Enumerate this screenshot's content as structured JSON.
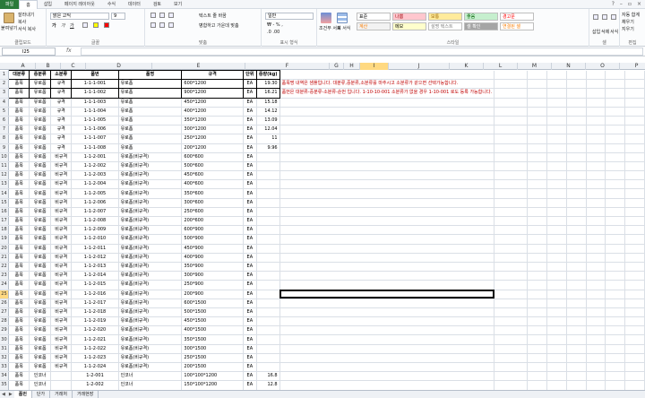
{
  "menu": {
    "file": "파일",
    "tabs": [
      "홈",
      "삽입",
      "페이지 레이아웃",
      "수식",
      "데이터",
      "검토",
      "보기"
    ],
    "active_index": 0
  },
  "ribbon": {
    "clipboard": {
      "label": "클립보드",
      "paste": "붙여넣기",
      "cut": "잘라내기",
      "copy": "복사",
      "format_painter": "서식 복사"
    },
    "font": {
      "label": "글꼴",
      "name": "맑은 고딕",
      "size": "9",
      "bold": "가",
      "italic": "가",
      "underline": "가"
    },
    "align": {
      "label": "맞춤",
      "wrap": "텍스트 줄 바꿈",
      "merge": "병합하고 가운데 맞춤"
    },
    "number": {
      "label": "표시 형식",
      "format": "일반"
    },
    "styles": {
      "label": "스타일",
      "cond": "조건부 서식",
      "table": "표 서식",
      "cells": [
        {
          "text": "표준",
          "bg": "#ffffff",
          "fg": "#000000"
        },
        {
          "text": "나쁨",
          "bg": "#ffc7ce",
          "fg": "#9c0006"
        },
        {
          "text": "보통",
          "bg": "#ffeb9c",
          "fg": "#9c6500"
        },
        {
          "text": "좋음",
          "bg": "#c6efce",
          "fg": "#006100"
        },
        {
          "text": "경고문",
          "bg": "#ffffff",
          "fg": "#ff0000"
        },
        {
          "text": "계산",
          "bg": "#f2f2f2",
          "fg": "#fa7d00"
        },
        {
          "text": "메모",
          "bg": "#ffffcc",
          "fg": "#000000"
        },
        {
          "text": "설명 텍스트",
          "bg": "#ffffff",
          "fg": "#7f7f7f"
        },
        {
          "text": "셀 확인",
          "bg": "#a5a5a5",
          "fg": "#ffffff"
        },
        {
          "text": "연결된 셀",
          "bg": "#ffffff",
          "fg": "#fa7d00"
        }
      ]
    },
    "cells": {
      "label": "셀",
      "insert": "삽입",
      "delete": "삭제",
      "format": "서식"
    },
    "editing": {
      "label": "편집",
      "autosum": "자동 합계",
      "fill": "채우기",
      "clear": "지우기"
    }
  },
  "formula_bar": {
    "name_box": "I25",
    "fx": "fx",
    "content": ""
  },
  "columns": [
    {
      "id": "A",
      "w": 28
    },
    {
      "id": "B",
      "w": 28
    },
    {
      "id": "C",
      "w": 28
    },
    {
      "id": "D",
      "w": 74
    },
    {
      "id": "E",
      "w": 104
    },
    {
      "id": "F",
      "w": 94
    },
    {
      "id": "G",
      "w": 16
    },
    {
      "id": "H",
      "w": 18
    },
    {
      "id": "I",
      "w": 32
    },
    {
      "id": "J",
      "w": 68
    },
    {
      "id": "K",
      "w": 38
    },
    {
      "id": "L",
      "w": 38
    },
    {
      "id": "M",
      "w": 38
    },
    {
      "id": "N",
      "w": 38
    },
    {
      "id": "O",
      "w": 38
    },
    {
      "id": "P",
      "w": 38
    }
  ],
  "selected_col": "I",
  "selected_row": 25,
  "headers": [
    "대분류",
    "중분류",
    "소분류",
    "품번",
    "품명",
    "규격",
    "단위",
    "중량(kg)"
  ],
  "notes": {
    "row2": "품목명 내역은 샘플입니다. 대분류,중분류,소분류를 마추시고 소분류가 같으면 선택가능합니다.",
    "row3": "품번은 대분류-중분류-소분류-순번 입니다. 1-10-10-001 소분류가 없을 경우 1-10-001 로도 등록 가능합니다."
  },
  "rows": [
    [
      "품목",
      "유로폼",
      "규격",
      "1-1-1-001",
      "유로폼",
      "600*1200",
      "EA",
      "19.30"
    ],
    [
      "품목",
      "유로폼",
      "규격",
      "1-1-1-002",
      "유로폼",
      "900*1200",
      "EA",
      "16.21"
    ],
    [
      "품목",
      "유로폼",
      "규격",
      "1-1-1-003",
      "유로폼",
      "450*1200",
      "EA",
      "15.18"
    ],
    [
      "품목",
      "유로폼",
      "규격",
      "1-1-1-004",
      "유로폼",
      "400*1200",
      "EA",
      "14.12"
    ],
    [
      "품목",
      "유로폼",
      "규격",
      "1-1-1-005",
      "유로폼",
      "350*1200",
      "EA",
      "13.09"
    ],
    [
      "품목",
      "유로폼",
      "규격",
      "1-1-1-006",
      "유로폼",
      "300*1200",
      "EA",
      "12.04"
    ],
    [
      "품목",
      "유로폼",
      "규격",
      "1-1-1-007",
      "유로폼",
      "250*1200",
      "EA",
      "11"
    ],
    [
      "품목",
      "유로폼",
      "규격",
      "1-1-1-008",
      "유로폼",
      "200*1200",
      "EA",
      "9.96"
    ],
    [
      "품목",
      "유로폼",
      "비규격",
      "1-1-2-001",
      "유로폼(비규격)",
      "600*600",
      "EA",
      ""
    ],
    [
      "품목",
      "유로폼",
      "비규격",
      "1-1-2-002",
      "유로폼(비규격)",
      "500*600",
      "EA",
      ""
    ],
    [
      "품목",
      "유로폼",
      "비규격",
      "1-1-2-003",
      "유로폼(비규격)",
      "450*600",
      "EA",
      ""
    ],
    [
      "품목",
      "유로폼",
      "비규격",
      "1-1-2-004",
      "유로폼(비규격)",
      "400*600",
      "EA",
      ""
    ],
    [
      "품목",
      "유로폼",
      "비규격",
      "1-1-2-005",
      "유로폼(비규격)",
      "350*600",
      "EA",
      ""
    ],
    [
      "품목",
      "유로폼",
      "비규격",
      "1-1-2-006",
      "유로폼(비규격)",
      "300*600",
      "EA",
      ""
    ],
    [
      "품목",
      "유로폼",
      "비규격",
      "1-1-2-007",
      "유로폼(비규격)",
      "250*600",
      "EA",
      ""
    ],
    [
      "품목",
      "유로폼",
      "비규격",
      "1-1-2-008",
      "유로폼(비규격)",
      "200*600",
      "EA",
      ""
    ],
    [
      "품목",
      "유로폼",
      "비규격",
      "1-1-2-009",
      "유로폼(비규격)",
      "600*900",
      "EA",
      ""
    ],
    [
      "품목",
      "유로폼",
      "비규격",
      "1-1-2-010",
      "유로폼(비규격)",
      "500*900",
      "EA",
      ""
    ],
    [
      "품목",
      "유로폼",
      "비규격",
      "1-1-2-011",
      "유로폼(비규격)",
      "450*900",
      "EA",
      ""
    ],
    [
      "품목",
      "유로폼",
      "비규격",
      "1-1-2-012",
      "유로폼(비규격)",
      "400*900",
      "EA",
      ""
    ],
    [
      "품목",
      "유로폼",
      "비규격",
      "1-1-2-013",
      "유로폼(비규격)",
      "350*900",
      "EA",
      ""
    ],
    [
      "품목",
      "유로폼",
      "비규격",
      "1-1-2-014",
      "유로폼(비규격)",
      "300*900",
      "EA",
      ""
    ],
    [
      "품목",
      "유로폼",
      "비규격",
      "1-1-2-015",
      "유로폼(비규격)",
      "250*900",
      "EA",
      ""
    ],
    [
      "품목",
      "유로폼",
      "비규격",
      "1-1-2-016",
      "유로폼(비규격)",
      "200*900",
      "EA",
      ""
    ],
    [
      "품목",
      "유로폼",
      "비규격",
      "1-1-2-017",
      "유로폼(비규격)",
      "600*1500",
      "EA",
      ""
    ],
    [
      "품목",
      "유로폼",
      "비규격",
      "1-1-2-018",
      "유로폼(비규격)",
      "500*1500",
      "EA",
      ""
    ],
    [
      "품목",
      "유로폼",
      "비규격",
      "1-1-2-019",
      "유로폼(비규격)",
      "450*1500",
      "EA",
      ""
    ],
    [
      "품목",
      "유로폼",
      "비규격",
      "1-1-2-020",
      "유로폼(비규격)",
      "400*1500",
      "EA",
      ""
    ],
    [
      "품목",
      "유로폼",
      "비규격",
      "1-1-2-021",
      "유로폼(비규격)",
      "350*1500",
      "EA",
      ""
    ],
    [
      "품목",
      "유로폼",
      "비규격",
      "1-1-2-022",
      "유로폼(비규격)",
      "300*1500",
      "EA",
      ""
    ],
    [
      "품목",
      "유로폼",
      "비규격",
      "1-1-2-023",
      "유로폼(비규격)",
      "250*1500",
      "EA",
      ""
    ],
    [
      "품목",
      "유로폼",
      "비규격",
      "1-1-2-024",
      "유로폼(비규격)",
      "200*1500",
      "EA",
      ""
    ],
    [
      "품목",
      "인코너",
      "",
      "1-2-001",
      "인코너",
      "100*100*1200",
      "EA",
      "16.8"
    ],
    [
      "품목",
      "인코너",
      "",
      "1-2-002",
      "인코너",
      "150*100*1200",
      "EA",
      "12.8"
    ],
    [
      "품목",
      "인코너",
      "",
      "1-2-003",
      "인코너",
      "150*150*1200",
      "EA",
      "13.6"
    ]
  ],
  "sheet_tabs": [
    "품번",
    "단가",
    "거래처",
    "거래현장"
  ],
  "active_sheet": 0
}
